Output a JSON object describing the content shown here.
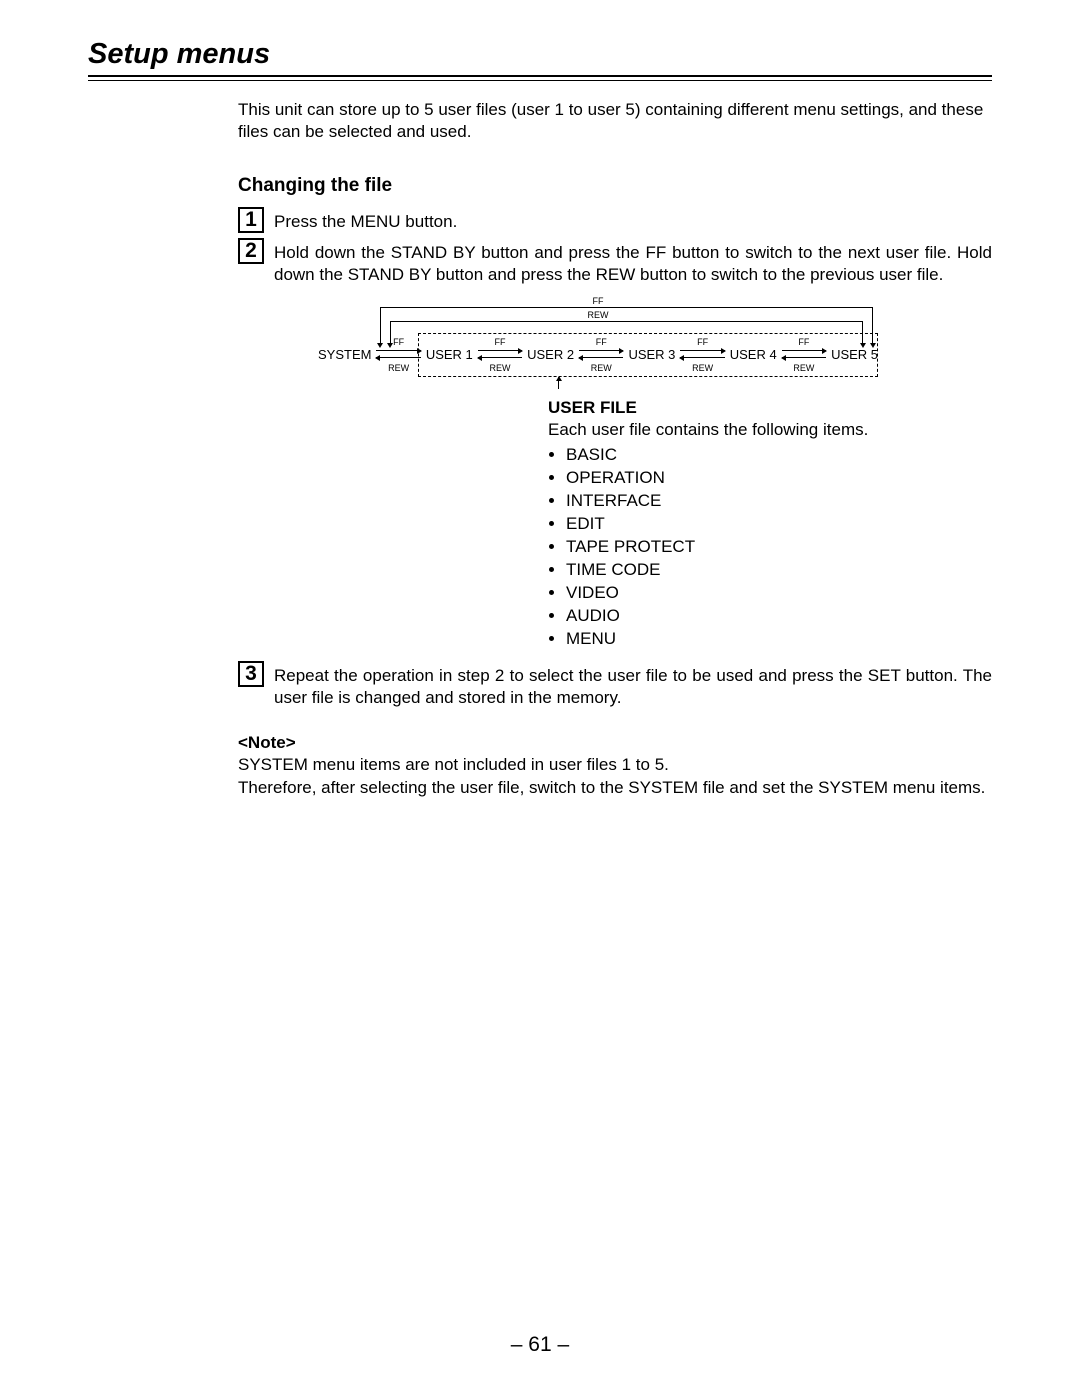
{
  "title": "Setup menus",
  "intro": "This unit can store up to 5 user files (user 1 to user 5) containing different menu settings, and these files can be selected and used.",
  "subheading": "Changing the file",
  "steps": [
    {
      "num": "1",
      "text": "Press the MENU button."
    },
    {
      "num": "2",
      "text": "Hold down the STAND BY button and press the FF button to switch to the next user file. Hold down the STAND BY button and press the REW button to switch to the previous user file."
    },
    {
      "num": "3",
      "text": "Repeat the operation in step 2 to select the user file to be used and press the SET button. The user file is changed and stored in the memory."
    }
  ],
  "diagram": {
    "topFF": "FF",
    "topREW": "REW",
    "linkFF": "FF",
    "linkREW": "REW",
    "nodes": [
      "SYSTEM",
      "USER 1",
      "USER 2",
      "USER 3",
      "USER 4",
      "USER 5"
    ]
  },
  "user_file": {
    "heading": "USER FILE",
    "lead": "Each user file contains the following items.",
    "items": [
      "BASIC",
      "OPERATION",
      "INTERFACE",
      "EDIT",
      "TAPE PROTECT",
      "TIME CODE",
      "VIDEO",
      "AUDIO",
      "MENU"
    ]
  },
  "note": {
    "heading": "<Note>",
    "line1": "SYSTEM menu items are not included in user files 1 to 5.",
    "line2": "Therefore, after selecting the user file, switch to the SYSTEM file and set the SYSTEM menu items."
  },
  "page_number": "– 61 –"
}
